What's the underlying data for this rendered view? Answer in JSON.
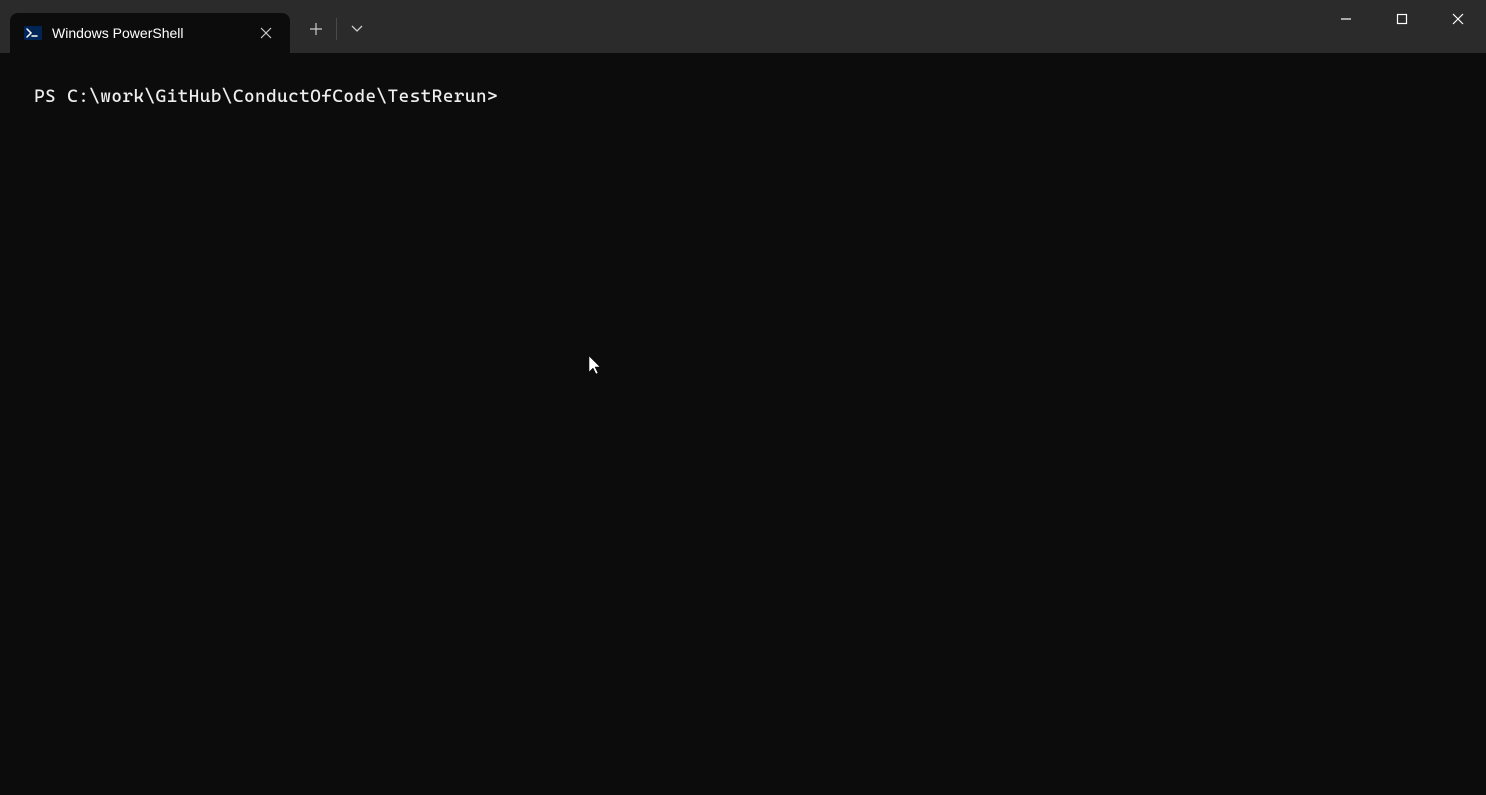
{
  "tab": {
    "title": "Windows PowerShell",
    "icon": "powershell-icon"
  },
  "terminal": {
    "prompt": "PS C:\\work\\GitHub\\ConductOfCode\\TestRerun>"
  },
  "colors": {
    "titlebar": "#2b2b2b",
    "terminal_bg": "#0c0c0c",
    "terminal_fg": "#cccccc",
    "ps_icon_bg": "#012456",
    "ps_icon_accent": "#ffffff"
  }
}
